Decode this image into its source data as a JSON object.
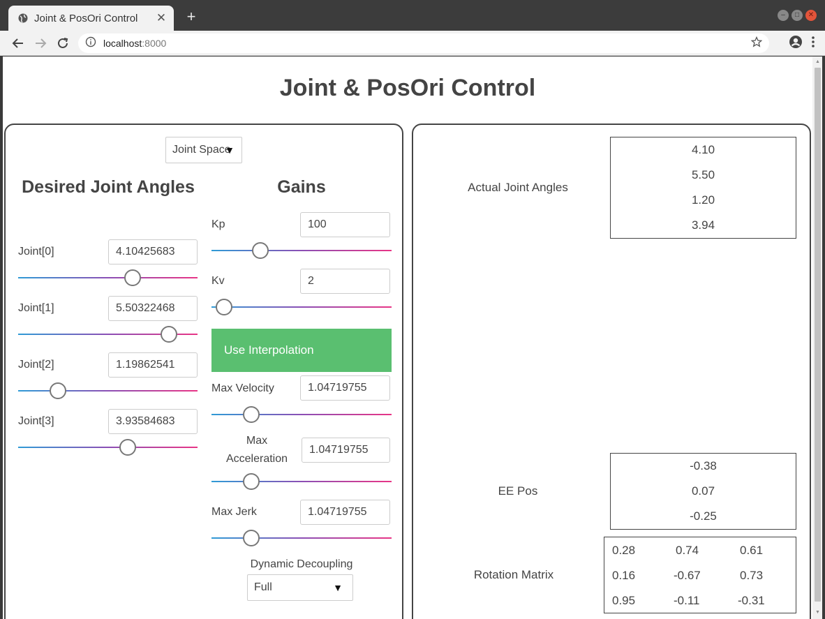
{
  "browser": {
    "tab_title": "Joint & PosOri Control",
    "new_tab": "+",
    "close_tab": "✕",
    "url_host": "localhost",
    "url_port": ":8000"
  },
  "page": {
    "title": "Joint & PosOri Control"
  },
  "left_panel": {
    "mode_select": "Joint Space",
    "desired_heading": "Desired Joint Angles",
    "gains_heading": "Gains",
    "joints": [
      {
        "label": "Joint[0]",
        "value": "4.10425683",
        "slider_fraction": 0.64
      },
      {
        "label": "Joint[1]",
        "value": "5.50322468",
        "slider_fraction": 0.84
      },
      {
        "label": "Joint[2]",
        "value": "1.19862541",
        "slider_fraction": 0.22
      },
      {
        "label": "Joint[3]",
        "value": "3.93584683",
        "slider_fraction": 0.61
      }
    ],
    "gains": {
      "kp_label": "Kp",
      "kp_value": "100",
      "kp_fraction": 0.27,
      "kv_label": "Kv",
      "kv_value": "2",
      "kv_fraction": 0.07
    },
    "interpolation_button": "Use Interpolation",
    "max_velocity_label": "Max Velocity",
    "max_velocity_value": "1.04719755",
    "max_velocity_fraction": 0.22,
    "max_accel_label_1": "Max",
    "max_accel_label_2": "Acceleration",
    "max_accel_value": "1.04719755",
    "max_accel_fraction": 0.22,
    "max_jerk_label": "Max Jerk",
    "max_jerk_value": "1.04719755",
    "max_jerk_fraction": 0.22,
    "decoupling_label": "Dynamic Decoupling",
    "decoupling_select": "Full"
  },
  "right_panel": {
    "actual_label": "Actual Joint Angles",
    "actual_values": [
      "4.10",
      "5.50",
      "1.20",
      "3.94"
    ],
    "ee_pos_label": "EE Pos",
    "ee_pos_values": [
      "-0.38",
      "0.07",
      "-0.25"
    ],
    "rotation_label": "Rotation Matrix",
    "rotation_rows": [
      [
        "0.28",
        "0.74",
        "0.61"
      ],
      [
        "0.16",
        "-0.67",
        "0.73"
      ],
      [
        "0.95",
        "-0.11",
        "-0.31"
      ]
    ]
  },
  "colors": {
    "interp_button": "#5abf70",
    "slider_start": "#2f9bd6",
    "slider_end": "#e83586",
    "close_button": "#e2543a"
  }
}
